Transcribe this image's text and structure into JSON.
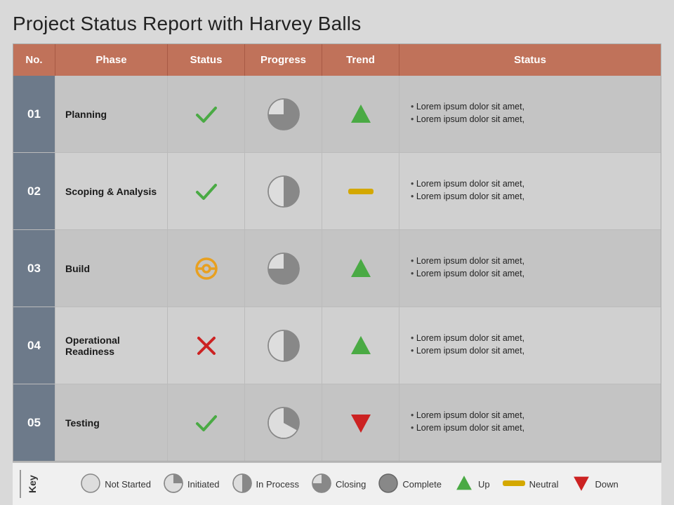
{
  "title": "Project Status Report with Harvey Balls",
  "header": {
    "cols": [
      "No.",
      "Phase",
      "Status",
      "Progress",
      "Trend",
      "Status"
    ]
  },
  "rows": [
    {
      "no": "01",
      "phase": "Planning",
      "status_icon": "check-green",
      "progress_fill": 0.75,
      "trend": "up",
      "notes": [
        "Lorem ipsum dolor sit amet,",
        "Lorem ipsum dolor sit amet,"
      ]
    },
    {
      "no": "02",
      "phase": "Scoping & Analysis",
      "status_icon": "check-green",
      "progress_fill": 0.5,
      "trend": "neutral",
      "notes": [
        "Lorem ipsum dolor sit amet,",
        "Lorem ipsum dolor sit amet,"
      ]
    },
    {
      "no": "03",
      "phase": "Build",
      "status_icon": "circle-orange",
      "progress_fill": 0.75,
      "trend": "up",
      "notes": [
        "Lorem ipsum dolor sit amet,",
        "Lorem ipsum dolor sit amet,"
      ]
    },
    {
      "no": "04",
      "phase": "Operational Readiness",
      "status_icon": "cross-red",
      "progress_fill": 0.5,
      "trend": "up",
      "notes": [
        "Lorem ipsum dolor sit amet,",
        "Lorem ipsum dolor sit amet,"
      ]
    },
    {
      "no": "05",
      "phase": "Testing",
      "status_icon": "check-green",
      "progress_fill": 0.33,
      "trend": "down",
      "notes": [
        "Lorem ipsum dolor sit amet,",
        "Lorem ipsum dolor sit amet,"
      ]
    }
  ],
  "key": {
    "label": "Key",
    "items": [
      {
        "label": "Not Started",
        "type": "harvey",
        "fill": 0
      },
      {
        "label": "Initiated",
        "type": "harvey",
        "fill": 0.25
      },
      {
        "label": "In Process",
        "type": "harvey",
        "fill": 0.5
      },
      {
        "label": "Closing",
        "type": "harvey",
        "fill": 0.75
      },
      {
        "label": "Complete",
        "type": "harvey",
        "fill": 1
      },
      {
        "label": "Up",
        "type": "arrow-up"
      },
      {
        "label": "Neutral",
        "type": "dash"
      },
      {
        "label": "Down",
        "type": "arrow-down"
      }
    ]
  }
}
